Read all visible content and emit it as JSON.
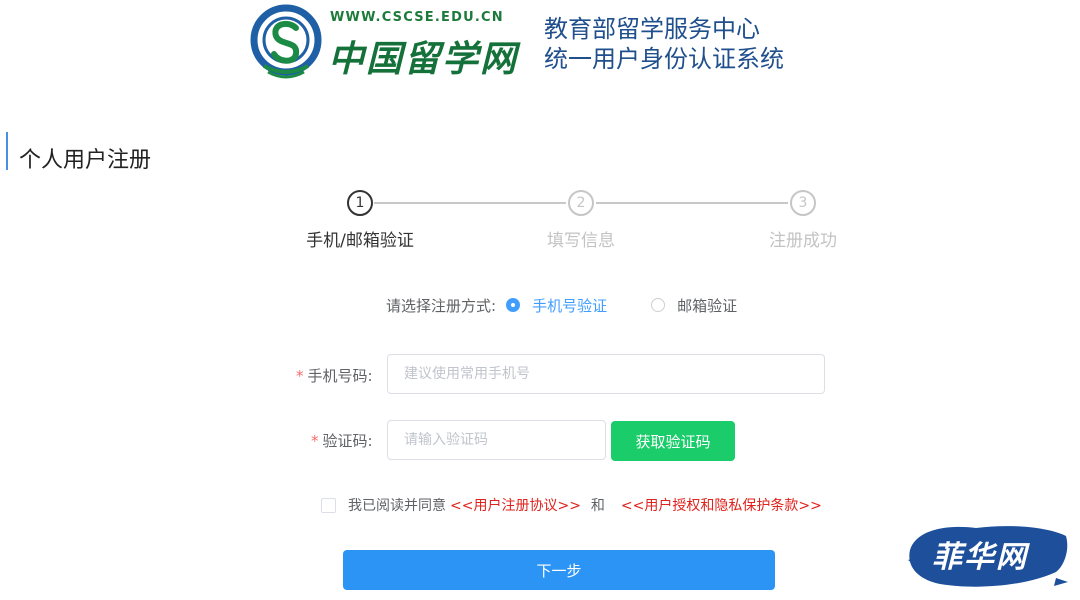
{
  "header": {
    "logo_url_text": "WWW.CSCSE.EDU.CN",
    "logo_cn_text": "中国留学网",
    "system_title_line1": "教育部留学服务中心",
    "system_title_line2": "统一用户身份认证系统"
  },
  "page_title": "个人用户注册",
  "steps": [
    {
      "number": "1",
      "label": "手机/邮箱验证",
      "active": true
    },
    {
      "number": "2",
      "label": "填写信息",
      "active": false
    },
    {
      "number": "3",
      "label": "注册成功",
      "active": false
    }
  ],
  "method": {
    "label": "请选择注册方式:",
    "options": [
      {
        "label": "手机号验证",
        "checked": true
      },
      {
        "label": "邮箱验证",
        "checked": false
      }
    ]
  },
  "form": {
    "phone": {
      "required_mark": "*",
      "label": "手机号码:",
      "placeholder": "建议使用常用手机号",
      "value": ""
    },
    "code": {
      "required_mark": "*",
      "label": "验证码:",
      "placeholder": "请输入验证码",
      "value": ""
    },
    "get_code_button": "获取验证码"
  },
  "agreement": {
    "checked": false,
    "prefix": "我已阅读并同意",
    "link1": "<<用户注册协议>>",
    "conjunction": "和",
    "link2": "<<用户授权和隐私保护条款>>"
  },
  "next_button": "下一步",
  "watermark": "菲华网",
  "colors": {
    "primary_blue": "#2b94f5",
    "green_button": "#1bcc6a",
    "link_red": "#e0221c",
    "title_blue": "#1f4f8c",
    "logo_green": "#14713a",
    "watermark_blue": "#1d4f9a"
  }
}
